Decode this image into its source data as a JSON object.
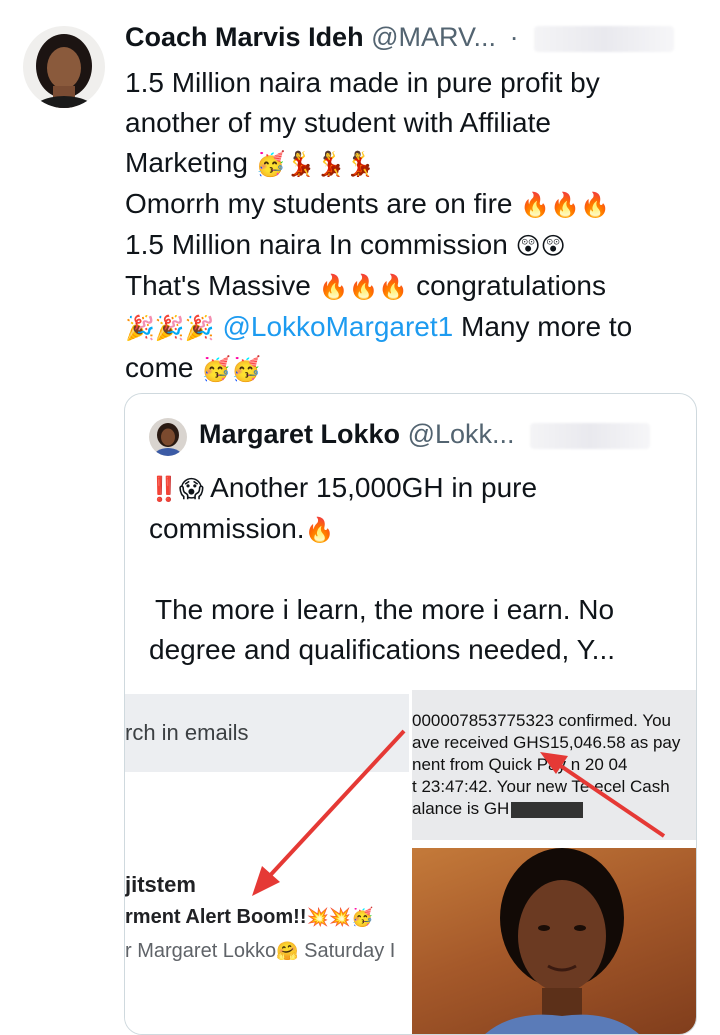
{
  "tweet": {
    "author_name": "Coach Marvis Ideh",
    "author_handle": "@MARV...",
    "separator": "·",
    "lines": [
      "1.5 Million naira made in pure profit by",
      "another of my student with Affiliate",
      "Marketing",
      "Omorrh my students are on fire",
      "1.5 Million naira In commission",
      "That's Massive",
      "congratulations",
      "@LokkoMargaret1",
      "Many more to",
      "come"
    ],
    "emojis": {
      "party_face": "🥳",
      "dancer": "💃",
      "fire": "🔥",
      "astonished": "😲",
      "popper": "🎉",
      "bangbang": "‼️",
      "scream": "😱",
      "collision": "💥",
      "hug": "🤗"
    }
  },
  "quote": {
    "author_name": "Margaret Lokko",
    "author_handle": "@Lokk...",
    "lines": [
      "Another 15,000GH in pure",
      "commission.",
      "The more i learn, the more i earn. No",
      "degree and qualifications needed, Y..."
    ]
  },
  "media": {
    "search_text": "rch in emails",
    "email_sender": "jitstem",
    "email_subject": "rment Alert Boom!!",
    "email_snippet": "r Margaret Lokko",
    "email_snippet_tail": "Saturday I",
    "sms_lines": [
      "000007853775323 confirmed. You",
      "ave received GHS15,046.58 as pay",
      "nent from Quick Pay    n 20      04",
      "t 23:47:42. Your new Te ecel Cash",
      "alance is GH"
    ]
  },
  "colors": {
    "mention": "#1d9bf0",
    "arrow": "#e53935",
    "handle": "#536471"
  }
}
